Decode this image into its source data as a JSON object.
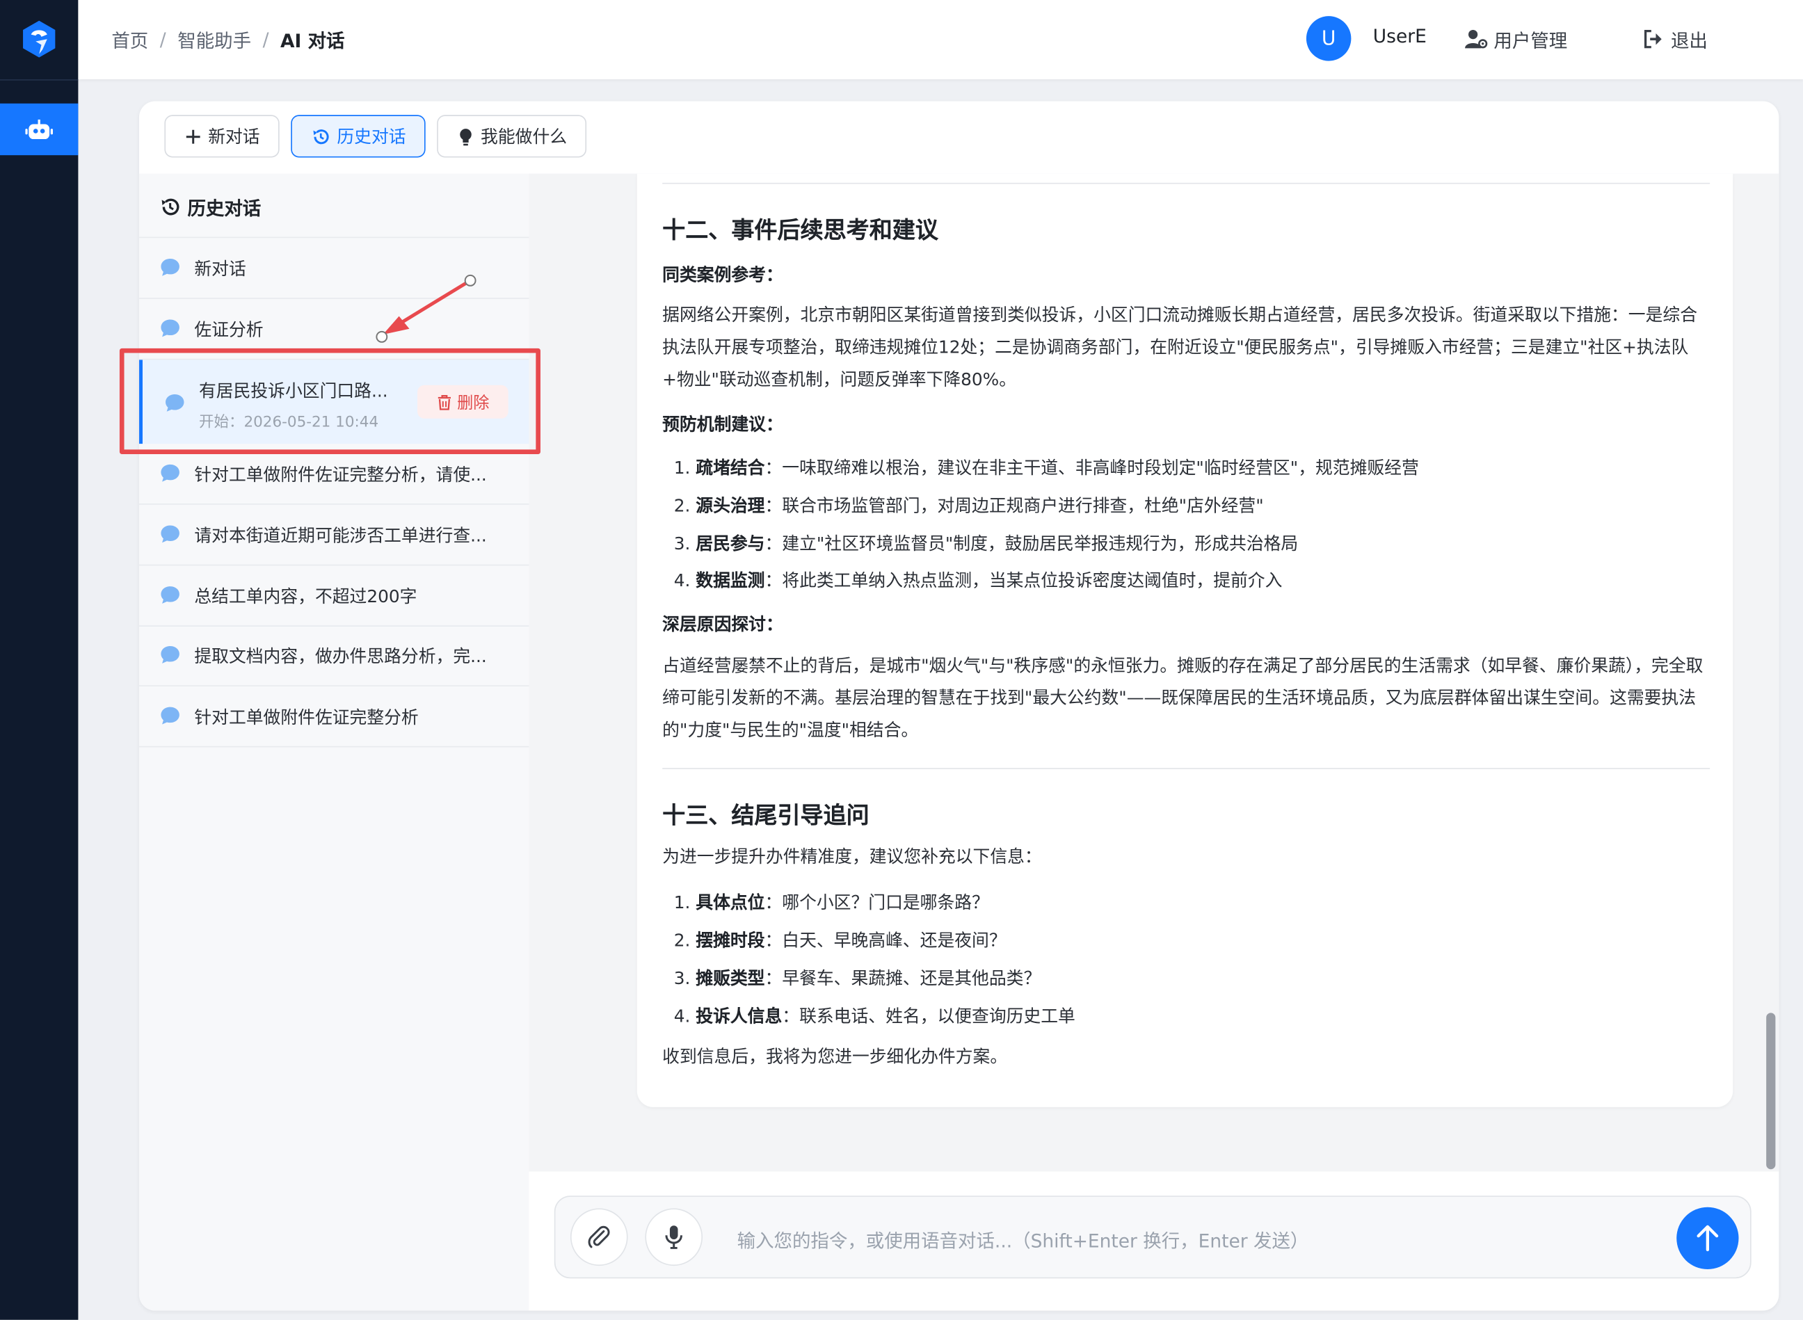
{
  "breadcrumb": {
    "items": [
      "首页",
      "智能助手",
      "AI 对话"
    ],
    "separator": "/"
  },
  "user": {
    "avatar_letter": "U",
    "name": "UserE"
  },
  "header_actions": {
    "user_mgmt": "用户管理",
    "logout": "退出"
  },
  "tabs": [
    {
      "label": "新对话",
      "active": false
    },
    {
      "label": "历史对话",
      "active": true
    },
    {
      "label": "我能做什么",
      "active": false
    }
  ],
  "history": {
    "title": "历史对话",
    "items": [
      {
        "title": "新对话"
      },
      {
        "title": "佐证分析"
      },
      {
        "title": "有居民投诉小区门口路...",
        "meta": "开始：2026-05-21 10:44",
        "selected": true,
        "delete_label": "删除"
      },
      {
        "title": "针对工单做附件佐证完整分析，请使..."
      },
      {
        "title": "请对本街道近期可能涉否工单进行查..."
      },
      {
        "title": "总结工单内容，不超过200字"
      },
      {
        "title": "提取文档内容，做办件思路分析，完..."
      },
      {
        "title": "针对工单做附件佐证完整分析"
      }
    ]
  },
  "message": {
    "section12": {
      "heading": "十二、事件后续思考和建议",
      "similar_label": "同类案例参考：",
      "similar_text": "据网络公开案例，北京市朝阳区某街道曾接到类似投诉，小区门口流动摊贩长期占道经营，居民多次投诉。街道采取以下措施：一是综合执法队开展专项整治，取缔违规摊位12处；二是协调商务部门，在附近设立\"便民服务点\"，引导摊贩入市经营；三是建立\"社区+执法队+物业\"联动巡查机制，问题反弹率下降80%。",
      "prevent_label": "预防机制建议：",
      "prevent_items": [
        {
          "num": "1.",
          "bold": "疏堵结合",
          "text": "：一味取缔难以根治，建议在非主干道、非高峰时段划定\"临时经营区\"，规范摊贩经营"
        },
        {
          "num": "2.",
          "bold": "源头治理",
          "text": "：联合市场监管部门，对周边正规商户进行排查，杜绝\"店外经营\""
        },
        {
          "num": "3.",
          "bold": "居民参与",
          "text": "：建立\"社区环境监督员\"制度，鼓励居民举报违规行为，形成共治格局"
        },
        {
          "num": "4.",
          "bold": "数据监测",
          "text": "：将此类工单纳入热点监测，当某点位投诉密度达阈值时，提前介入"
        }
      ],
      "deep_label": "深层原因探讨：",
      "deep_text": "占道经营屡禁不止的背后，是城市\"烟火气\"与\"秩序感\"的永恒张力。摊贩的存在满足了部分居民的生活需求（如早餐、廉价果蔬），完全取缔可能引发新的不满。基层治理的智慧在于找到\"最大公约数\"——既保障居民的生活环境品质，又为底层群体留出谋生空间。这需要执法的\"力度\"与民生的\"温度\"相结合。"
    },
    "section13": {
      "heading": "十三、结尾引导追问",
      "intro": "为进一步提升办件精准度，建议您补充以下信息：",
      "items": [
        {
          "num": "1.",
          "bold": "具体点位",
          "text": "：哪个小区？门口是哪条路？"
        },
        {
          "num": "2.",
          "bold": "摆摊时段",
          "text": "：白天、早晚高峰、还是夜间？"
        },
        {
          "num": "3.",
          "bold": "摊贩类型",
          "text": "：早餐车、果蔬摊、还是其他品类？"
        },
        {
          "num": "4.",
          "bold": "投诉人信息",
          "text": "：联系电话、姓名，以便查询历史工单"
        }
      ],
      "closing": "收到信息后，我将为您进一步细化办件方案。"
    }
  },
  "input": {
    "placeholder": "输入您的指令，或使用语音对话...（Shift+Enter 换行，Enter 发送）"
  },
  "colors": {
    "accent": "#1677ff",
    "rail": "#0f1a2d",
    "highlight_box": "#e84a4e",
    "danger": "#e04a4a"
  },
  "icons": [
    "app-logo-icon",
    "robot-icon",
    "user-settings-icon",
    "logout-icon",
    "plus-icon",
    "history-icon",
    "bulb-icon",
    "chat-bubble-icon",
    "trash-icon",
    "paperclip-icon",
    "microphone-icon",
    "arrow-up-icon"
  ]
}
